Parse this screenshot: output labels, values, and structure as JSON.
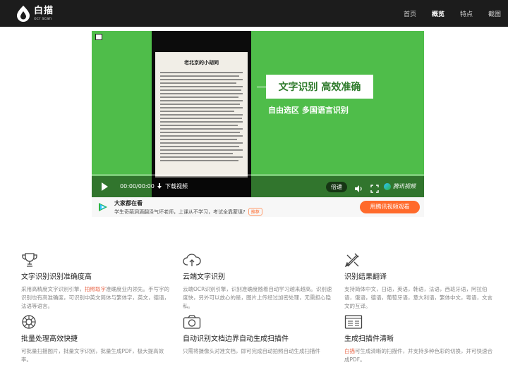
{
  "nav": {
    "logo_title": "白描",
    "logo_sub": "ocr scan",
    "links": [
      "首页",
      "概览",
      "特点",
      "截图"
    ],
    "active_index": 1
  },
  "video": {
    "doc_title": "老北京的小胡同",
    "slogan_title": "文字识别 高效准确",
    "slogan_sub": "自由选区 多国语言识别",
    "time": "00:00/00:00",
    "download_label": "下载视频",
    "speed_label": "倍速",
    "brand": "腾讯视频"
  },
  "promo": {
    "title": "大家都在看",
    "desc": "学生奇葩洞酒翻泽气坏老师，上课从不学习，考试全靠蒙填?",
    "tag": "推荐",
    "button": "用腾讯视频观看"
  },
  "features": [
    {
      "icon": "trophy-icon",
      "title": "文字识别识别准确度高",
      "desc_parts": [
        "采用高精度文字识别引擎，",
        "拍照取字",
        "准确度业内领先。手写字的识别也有高准确度，可识别中英文简体与繁体字，英文，德语，法语等语言。"
      ]
    },
    {
      "icon": "cloud-upload-icon",
      "title": "云端文字识别",
      "desc_parts": [
        "云端OCR识别引擎，识别准确度随着自动学习越来越高。识别速度快，另外可以放心的是，图片上传经过加密处理，无需担心隐私。"
      ]
    },
    {
      "icon": "translate-icon",
      "title": "识别结果翻译",
      "desc_parts": [
        "支持简体中文，日语，英语，韩语，法语，西班牙语，阿拉伯语，俄语，德语，葡萄牙语，意大利语，繁体中文，粤语，文言文的互译。"
      ]
    },
    {
      "icon": "batch-icon",
      "title": "批量处理高效快捷",
      "desc_parts": [
        "可批量扫描图片，批量文字识别，批量生成PDF，极大提高效率。"
      ]
    },
    {
      "icon": "camera-icon",
      "title": "自动识别文档边界自动生成扫描件",
      "desc_parts": [
        "只需将摄像头对准文档，即可完成自动拍照自动生成扫描件"
      ]
    },
    {
      "icon": "document-scan-icon",
      "title": "生成扫描件清晰",
      "desc_parts": [
        "",
        "白描",
        "可生成清晰的扫描件，并支持多种色彩的切换，并可快速合成PDF。"
      ]
    }
  ],
  "colors": {
    "nav_bg": "#1c1c1c",
    "video_green": "#4fbd4a",
    "accent_orange": "#ff6a2b",
    "highlight": "#e8674a"
  }
}
